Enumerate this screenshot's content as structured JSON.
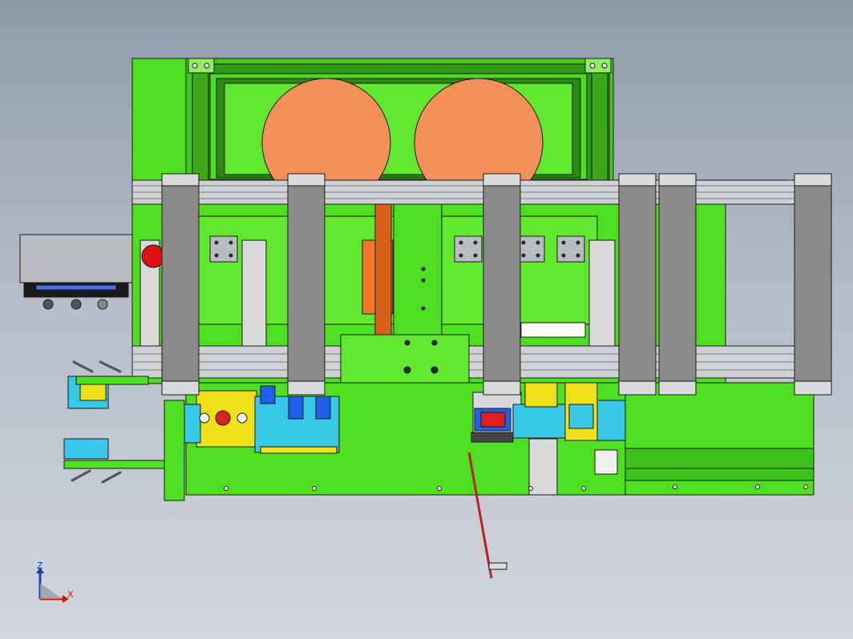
{
  "view": {
    "axis_triad": {
      "z_label": "Z",
      "x_label": "X"
    }
  },
  "colors": {
    "frame_green": "#4ee020",
    "plate_green": "#5fe82e",
    "edge": "#1a1a1a",
    "reel_orange": "#f59058",
    "slot_orange": "#f07a2a",
    "column_gray": "#8c8a88",
    "aluminum": "#d8dadc",
    "gray_box": "#b9bcc0",
    "jig_yellow": "#f0e018",
    "jig_cyan": "#38c8e8",
    "jig_blue": "#1e60e8",
    "lever_red": "#c02020",
    "stop_button_red": "#e01010",
    "axis_z": "#1a3cc8",
    "axis_x": "#d01818",
    "background_top": "#8e9aab",
    "background_bottom": "#d3d7de"
  }
}
